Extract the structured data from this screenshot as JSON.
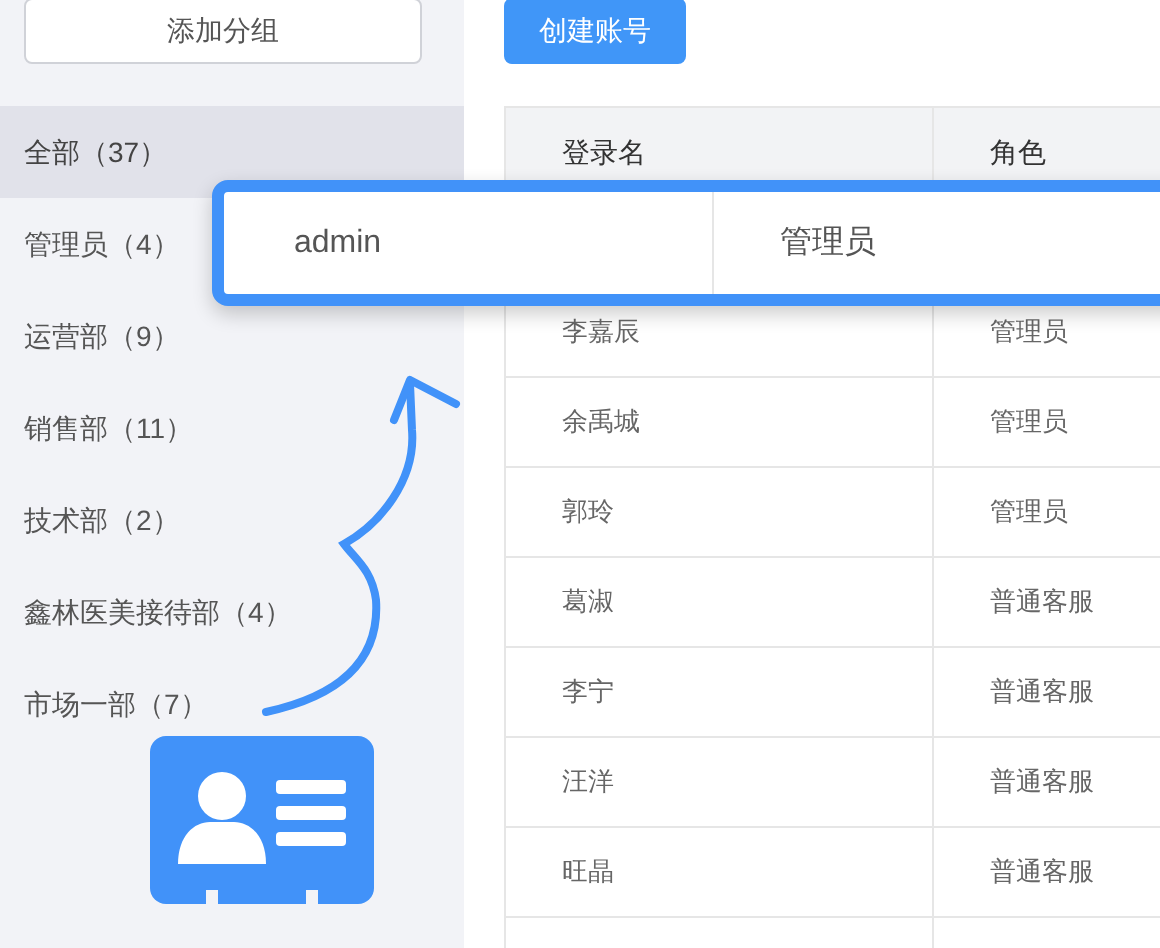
{
  "sidebar": {
    "add_button": "添加分组",
    "groups": [
      {
        "label": "全部（37）",
        "selected": true
      },
      {
        "label": "管理员（4）",
        "selected": false
      },
      {
        "label": "运营部（9）",
        "selected": false
      },
      {
        "label": "销售部（11）",
        "selected": false
      },
      {
        "label": "技术部（2）",
        "selected": false
      },
      {
        "label": "鑫林医美接待部（4）",
        "selected": false
      },
      {
        "label": "市场一部（7）",
        "selected": false
      }
    ]
  },
  "create_button": "创建账号",
  "table": {
    "columns": [
      "登录名",
      "角色"
    ],
    "rows": [
      [
        "李嘉辰",
        "管理员"
      ],
      [
        "余禹城",
        "管理员"
      ],
      [
        "郭玲",
        "管理员"
      ],
      [
        "葛淑",
        "普通客服"
      ],
      [
        "李宁",
        "普通客服"
      ],
      [
        "汪洋",
        "普通客服"
      ],
      [
        "旺晶",
        "普通客服"
      ]
    ]
  },
  "highlighted_row": [
    "admin",
    "管理员"
  ]
}
